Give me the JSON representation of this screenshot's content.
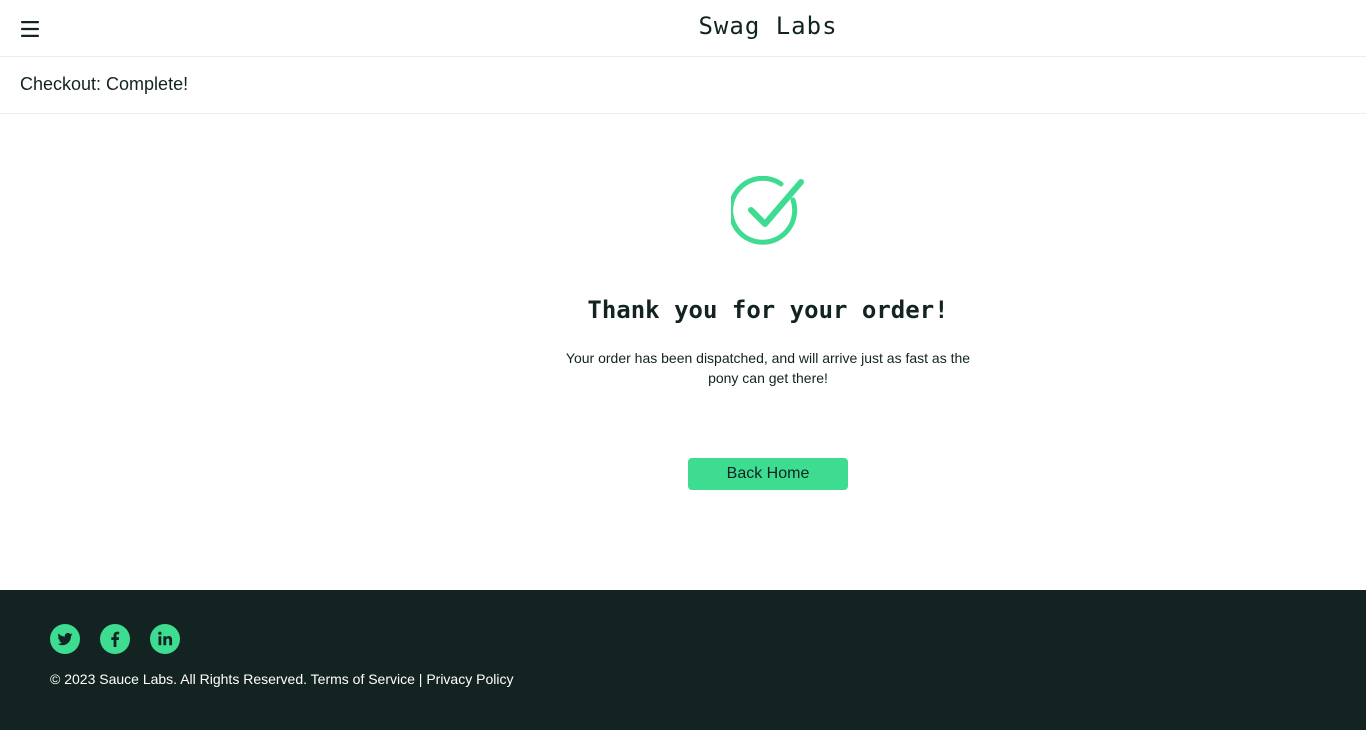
{
  "header": {
    "logo": "Swag Labs",
    "menu_icon": "hamburger-icon"
  },
  "secondary_header": {
    "title": "Checkout: Complete!"
  },
  "complete": {
    "icon": "checkmark-circle-icon",
    "heading": "Thank you for your order!",
    "text": "Your order has been dispatched, and will arrive just as fast as the pony can get there!",
    "back_button_label": "Back Home"
  },
  "footer": {
    "social": [
      {
        "name": "twitter",
        "icon": "twitter-icon"
      },
      {
        "name": "facebook",
        "icon": "facebook-icon"
      },
      {
        "name": "linkedin",
        "icon": "linkedin-icon"
      }
    ],
    "copyright": "© 2023 Sauce Labs. All Rights Reserved. Terms of Service | Privacy Policy"
  },
  "colors": {
    "accent": "#3ddc91",
    "footer_bg": "#132322",
    "text": "#132322"
  }
}
